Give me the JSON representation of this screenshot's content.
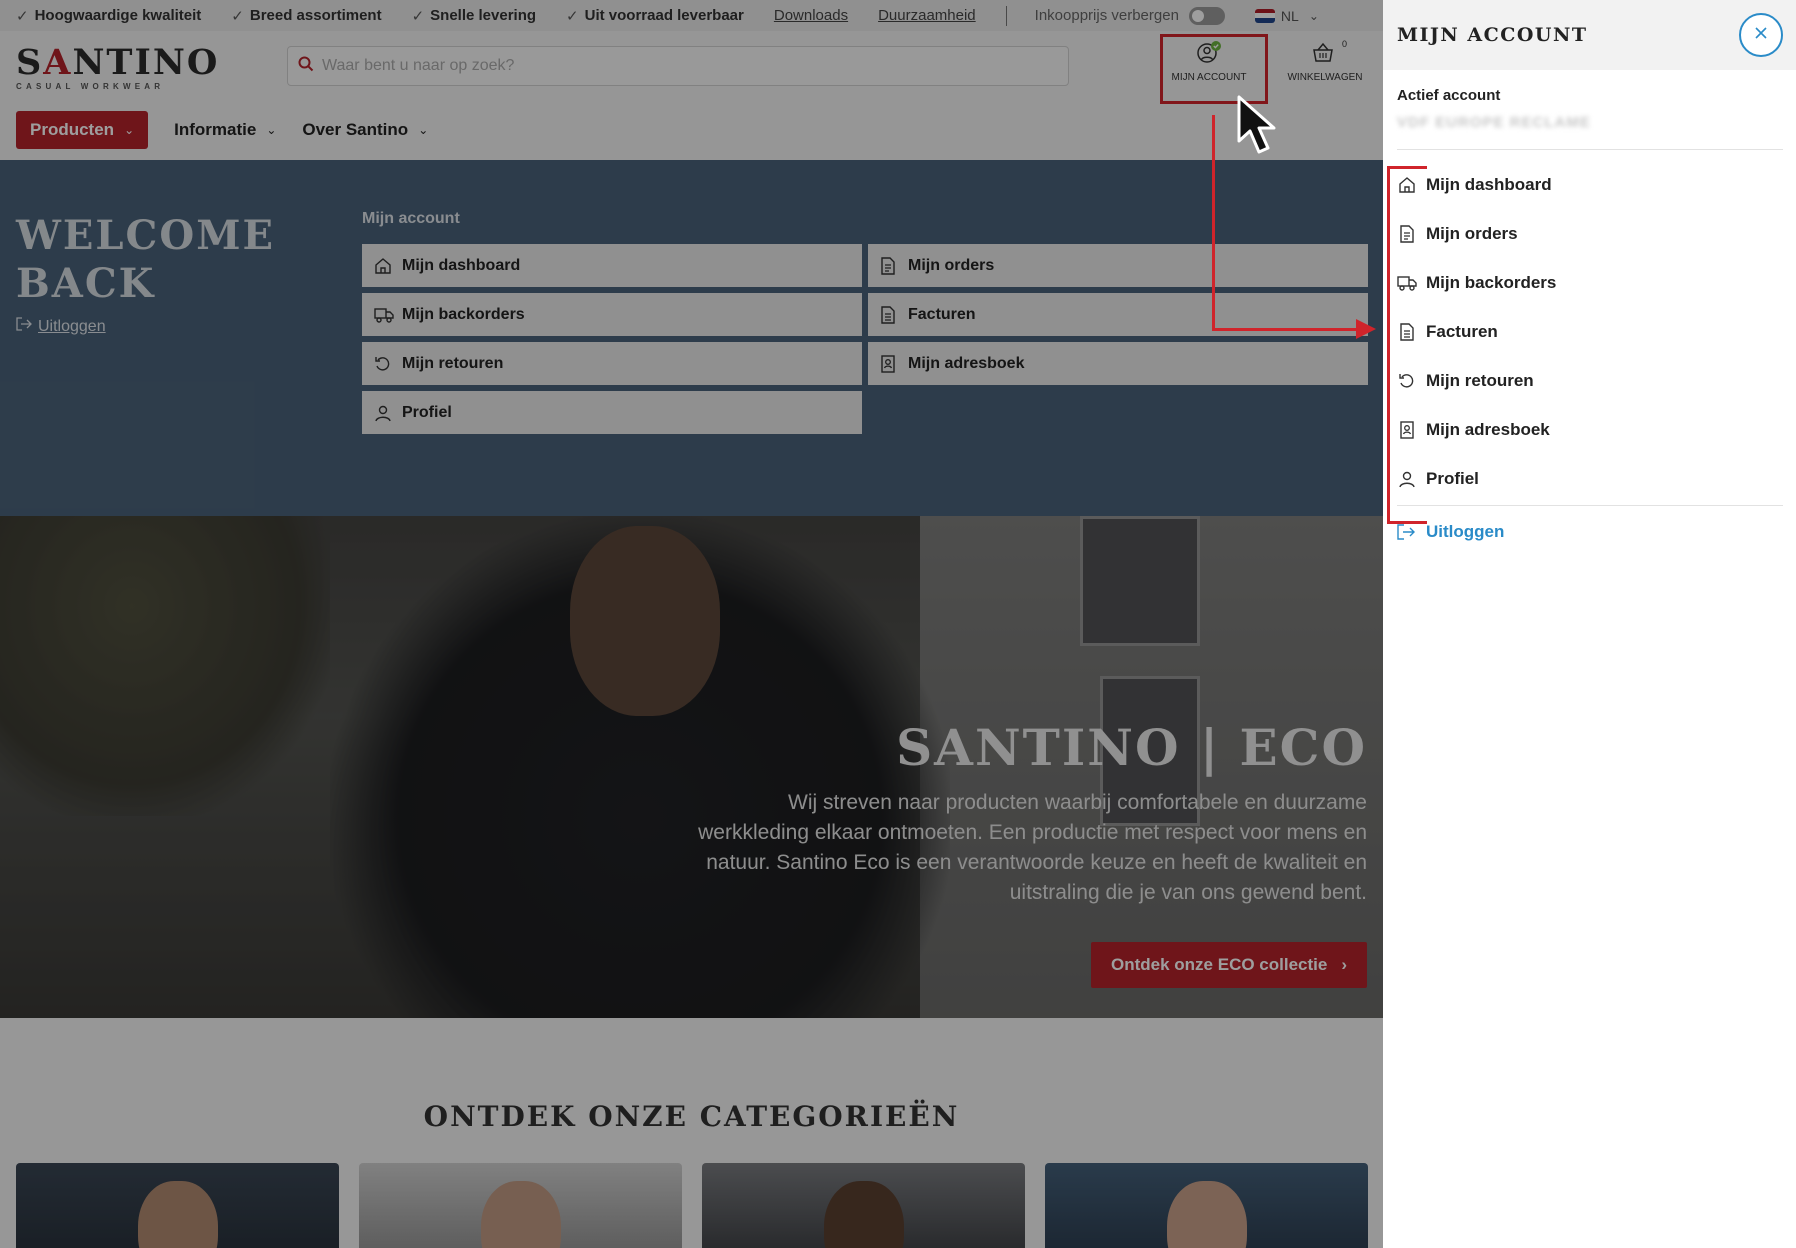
{
  "topbar": {
    "usps": [
      "Hoogwaardige kwaliteit",
      "Breed assortiment",
      "Snelle levering",
      "Uit voorraad leverbaar"
    ],
    "links": [
      "Downloads",
      "Duurzaamheid"
    ],
    "toggle_label": "Inkoopprijs verbergen",
    "language": "NL"
  },
  "header": {
    "logo_main": "SANTINO",
    "logo_sub": "CASUAL WORKWEAR",
    "search_placeholder": "Waar bent u naar op zoek?",
    "account_label": "MIJN ACCOUNT",
    "cart_label": "WINKELWAGEN",
    "cart_count": "0"
  },
  "nav": {
    "items": [
      "Producten",
      "Informatie",
      "Over Santino"
    ]
  },
  "welcome": {
    "title": "WELCOME BACK",
    "logout": "Uitloggen",
    "account_heading": "Mijn account",
    "tiles": [
      "Mijn dashboard",
      "Mijn orders",
      "Mijn backorders",
      "Facturen",
      "Mijn retouren",
      "Mijn adresboek",
      "Profiel"
    ]
  },
  "hero": {
    "title": "SANTINO | ECO",
    "text": "Wij streven naar producten waarbij comfortabele en duurzame werkkleding elkaar ontmoeten. Een productie met respect voor mens en natuur. Santino Eco is een verantwoorde keuze en heeft de kwaliteit en uitstraling die je van ons gewend bent.",
    "cta": "Ontdek onze ECO collectie"
  },
  "categories": {
    "title": "ONTDEK ONZE CATEGORIEËN"
  },
  "panel": {
    "title": "MIJN ACCOUNT",
    "active_label": "Actief account",
    "active_value": "VDF EUROPE RECLAME",
    "menu": [
      "Mijn dashboard",
      "Mijn orders",
      "Mijn backorders",
      "Facturen",
      "Mijn retouren",
      "Mijn adresboek",
      "Profiel"
    ],
    "logout": "Uitloggen"
  },
  "colors": {
    "brand_red": "#b4232b",
    "annotation_red": "#d0242b",
    "link_blue": "#2a8bc8",
    "welcome_bg": "#4a6279"
  }
}
